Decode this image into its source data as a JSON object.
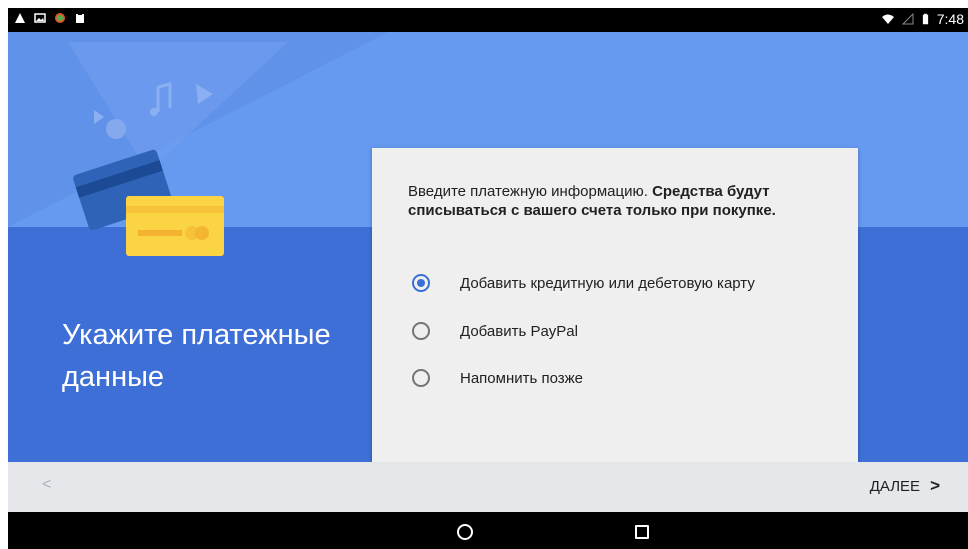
{
  "status_bar": {
    "time": "7:48",
    "left_icons": [
      "warning-icon",
      "image-icon",
      "app-icon",
      "clipboard-icon"
    ],
    "right_icons": [
      "wifi-icon",
      "signal-icon",
      "battery-icon"
    ]
  },
  "hero": {
    "headline": "Укажите платежные данные"
  },
  "card": {
    "intro_text": "Введите платежную информацию. ",
    "intro_bold": "Средства будут списываться с вашего счета только при покупке.",
    "options": [
      {
        "label": "Добавить кредитную или дебетовую карту",
        "selected": true
      },
      {
        "label": "Добавить PayPal",
        "selected": false
      },
      {
        "label": "Напомнить позже",
        "selected": false
      }
    ]
  },
  "nav": {
    "prev_symbol": "<",
    "next_label": "ДАЛЕЕ",
    "next_symbol": ">"
  },
  "colors": {
    "hero_upper": "#6699f0",
    "hero_lower": "#3e6fd6",
    "accent": "#3b6fd8",
    "card_bg": "#efefef"
  }
}
